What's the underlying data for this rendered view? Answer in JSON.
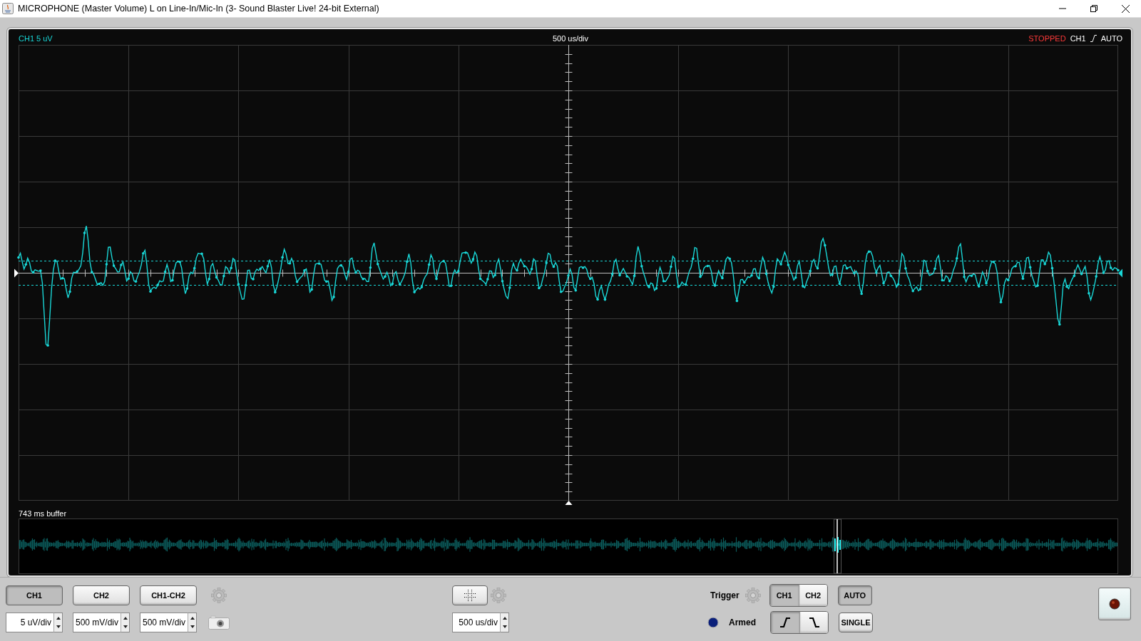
{
  "window": {
    "title": "MICROPHONE (Master Volume) L on Line-In/Mic-In (3- Sound Blaster Live! 24-bit External)"
  },
  "scope": {
    "channel_label": "CH1 5 uV",
    "timebase_label": "500 us/div",
    "status": "STOPPED",
    "trigger_source": "CH1",
    "trigger_mode": "AUTO"
  },
  "buffer": {
    "label": "743 ms buffer"
  },
  "channels": [
    {
      "label": "CH1",
      "selected": true,
      "scale": "5 uV/div"
    },
    {
      "label": "CH2",
      "selected": false,
      "scale": "500 mV/div"
    },
    {
      "label": "CH1-CH2",
      "selected": false,
      "scale": "500 mV/div"
    }
  ],
  "timebase": {
    "scale": "500 us/div"
  },
  "trigger": {
    "label": "Trigger",
    "armed": {
      "label": "Armed",
      "on": true
    },
    "sources": [
      {
        "label": "CH1",
        "selected": true
      },
      {
        "label": "CH2",
        "selected": false
      }
    ],
    "slopes": [
      {
        "kind": "rising",
        "selected": true
      },
      {
        "kind": "falling",
        "selected": false
      }
    ],
    "modes": [
      {
        "label": "AUTO",
        "selected": true
      },
      {
        "label": "SINGLE",
        "selected": false
      }
    ]
  }
}
